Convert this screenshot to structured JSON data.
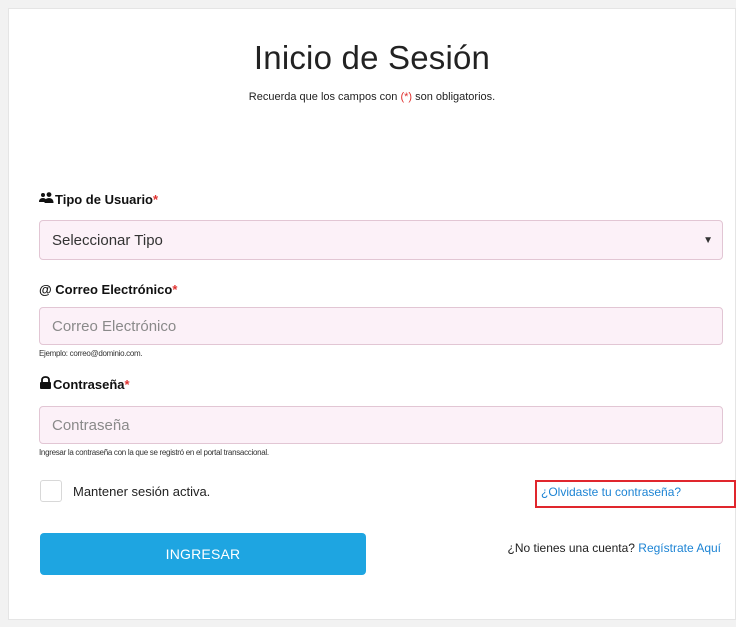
{
  "header": {
    "title": "Inicio de Sesión",
    "subtitle_before": "Recuerda que los campos con ",
    "subtitle_marker": "(*)",
    "subtitle_after": " son obligatorios."
  },
  "user_type": {
    "label": "Tipo de Usuario",
    "required_mark": "*",
    "selected": "Seleccionar Tipo"
  },
  "email": {
    "label": "@ Correo Electrónico",
    "required_mark": "*",
    "placeholder": "Correo Electrónico",
    "value": "",
    "hint": "Ejemplo: correo@dominio.com."
  },
  "password": {
    "label": "Contraseña",
    "required_mark": "*",
    "placeholder": "Contraseña",
    "value": "",
    "hint": "Ingresar la contraseña con la que se registró en el portal transaccional."
  },
  "remember": {
    "label": "Mantener sesión activa."
  },
  "forgot": {
    "label": "¿Olvidaste tu contraseña?"
  },
  "submit": {
    "label": "INGRESAR"
  },
  "signup": {
    "prompt": "¿No tienes una cuenta?",
    "link": "Regístrate Aquí"
  },
  "icons": {
    "user_type": "users-icon",
    "password": "lock-icon",
    "select": "caret-down-icon"
  },
  "colors": {
    "primary_button": "#1ea5e1",
    "link": "#1d84d4",
    "required": "#e0312f",
    "highlight_box": "#e0262d",
    "field_bg": "#fcf1f8"
  }
}
